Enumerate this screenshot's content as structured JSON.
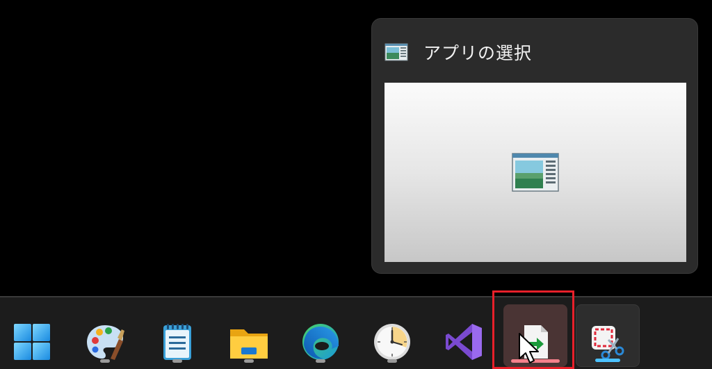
{
  "preview": {
    "title": "アプリの選択",
    "app_icon": "app-window-icon"
  },
  "taskbar": {
    "items": [
      {
        "name": "start-button",
        "icon": "windows-logo-icon"
      },
      {
        "name": "paint-button",
        "icon": "paint-palette-icon"
      },
      {
        "name": "notepad-button",
        "icon": "notepad-icon"
      },
      {
        "name": "file-explorer-button",
        "icon": "folder-icon"
      },
      {
        "name": "edge-button",
        "icon": "edge-browser-icon"
      },
      {
        "name": "clock-button",
        "icon": "clock-icon"
      },
      {
        "name": "visual-studio-button",
        "icon": "visual-studio-icon"
      },
      {
        "name": "open-with-button",
        "icon": "document-arrow-icon",
        "state": "hovered"
      },
      {
        "name": "snipping-tool-button",
        "icon": "snipping-tool-icon",
        "state": "active"
      }
    ]
  },
  "colors": {
    "taskbar_bg": "#1c1c1c",
    "preview_bg": "#2b2b2b",
    "highlight": "#e8202a",
    "active_indicator": "#4cc2ff",
    "hover_indicator": "#f4808b"
  }
}
